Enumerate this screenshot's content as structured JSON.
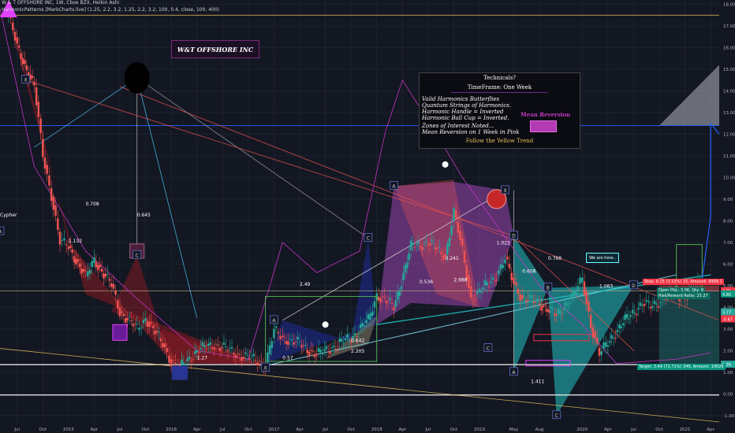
{
  "header": {
    "line1": "W & T OFFSHORE INC, 1W, Cboe BZX, Heikin Ashi",
    "line2": "HarmonicPatterns [MarkCharts.live] (1.25, 2.2, 3.2, 1.25, 2.2, 3.2, 100, 0.4, close, 100, 400)"
  },
  "title_box": "W&T OFFSHORE INC",
  "panel": {
    "heading": "Technicals?",
    "timeframe": "TimeFrame: One Week",
    "lines": [
      "Valid Harmonics Butterflies",
      "Quantum Strings of Harmonics.",
      "Harmonic Handle = Inverted",
      "Harmonic Ball Cup = Inverted."
    ],
    "lines2": [
      "Zones of Interest Noted...",
      "Mean Reversion on 1 Week in Pink"
    ],
    "mean_reversion": "Mean Reversion",
    "follow": "Follow the Yellow Trend"
  },
  "we_are_here": "We are here..",
  "position": {
    "stop": "Stop: 0.15 (3.13%) 15, Amount: 9999.1",
    "open": "Open P&L: 3.06, Qty: 6",
    "ratio": "Risk/Reward Ratio: 23.27",
    "target": "Target: 3.49 (72.71%) 349, Amount: 10026"
  },
  "price_tags": [
    {
      "label": "4.75",
      "y": 4.75,
      "color": "#f23645"
    },
    {
      "label": "4.80",
      "y": 4.6,
      "color": "#089981"
    },
    {
      "label": "3.77",
      "y": 3.77,
      "color": "#26a69a"
    },
    {
      "label": "-0.67",
      "y": 3.45,
      "color": "#f23645"
    },
    {
      "label": "1.35",
      "y": 1.35,
      "color": "#26a69a"
    }
  ],
  "colors": {
    "background": "#131722",
    "up": "#26a69a",
    "down": "#ef5350",
    "cup": "#b84fd0",
    "butterfly_red": "#8b1a22",
    "teal": "#22c1c3",
    "blue": "#1c2a8a",
    "yellow": "#e8c25a"
  },
  "chart_data": {
    "type": "candlestick",
    "title": "W & T OFFSHORE INC, 1W, Cboe BZX, Heikin Ashi",
    "xlabel": "",
    "ylabel": "",
    "ylim": [
      -1.3,
      18.2
    ],
    "y_ticks": [
      -1.0,
      0.0,
      1.0,
      2.0,
      3.0,
      4.0,
      5.0,
      6.0,
      7.0,
      8.0,
      9.0,
      10.0,
      11.0,
      12.0,
      13.0,
      14.0,
      15.0,
      16.0,
      17.0,
      18.0
    ],
    "x_range": [
      "2014-05",
      "2021-05"
    ],
    "x_ticks": [
      {
        "label": "Jul",
        "date": "2014-07"
      },
      {
        "label": "Oct",
        "date": "2014-10"
      },
      {
        "label": "2015",
        "date": "2015-01"
      },
      {
        "label": "Apr",
        "date": "2015-04"
      },
      {
        "label": "Jul",
        "date": "2015-07"
      },
      {
        "label": "Oct",
        "date": "2015-10"
      },
      {
        "label": "2016",
        "date": "2016-01"
      },
      {
        "label": "Apr",
        "date": "2016-04"
      },
      {
        "label": "Jul",
        "date": "2016-07"
      },
      {
        "label": "Oct",
        "date": "2016-10"
      },
      {
        "label": "2017",
        "date": "2017-01"
      },
      {
        "label": "Apr",
        "date": "2017-04"
      },
      {
        "label": "Jul",
        "date": "2017-07"
      },
      {
        "label": "Oct",
        "date": "2017-10"
      },
      {
        "label": "2018",
        "date": "2018-01"
      },
      {
        "label": "Apr",
        "date": "2018-04"
      },
      {
        "label": "Jul",
        "date": "2018-07"
      },
      {
        "label": "Oct",
        "date": "2018-10"
      },
      {
        "label": "2019",
        "date": "2019-01"
      },
      {
        "label": "May",
        "date": "2019-05"
      },
      {
        "label": "Aug",
        "date": "2019-08"
      },
      {
        "label": "2020",
        "date": "2020-01"
      },
      {
        "label": "Apr",
        "date": "2020-04"
      },
      {
        "label": "Jul",
        "date": "2020-07"
      },
      {
        "label": "Oct",
        "date": "2020-10"
      },
      {
        "label": "2021",
        "date": "2021-01"
      },
      {
        "label": "Apr",
        "date": "2021-04"
      }
    ],
    "price_path": [
      [
        "2014-06",
        17.5
      ],
      [
        "2014-07",
        16.0
      ],
      [
        "2014-09",
        14.2
      ],
      [
        "2014-10",
        11.0
      ],
      [
        "2014-11",
        9.2
      ],
      [
        "2014-12",
        7.0
      ],
      [
        "2015-01",
        6.8
      ],
      [
        "2015-03",
        5.4
      ],
      [
        "2015-04",
        6.2
      ],
      [
        "2015-06",
        5.0
      ],
      [
        "2015-07",
        3.8
      ],
      [
        "2015-09",
        3.0
      ],
      [
        "2015-10",
        3.5
      ],
      [
        "2015-12",
        2.3
      ],
      [
        "2016-01",
        1.5
      ],
      [
        "2016-02",
        1.2
      ],
      [
        "2016-04",
        2.0
      ],
      [
        "2016-06",
        2.3
      ],
      [
        "2016-09",
        1.8
      ],
      [
        "2016-12",
        1.4
      ],
      [
        "2017-01",
        2.9
      ],
      [
        "2017-02",
        2.6
      ],
      [
        "2017-04",
        2.3
      ],
      [
        "2017-06",
        1.8
      ],
      [
        "2017-08",
        2.2
      ],
      [
        "2017-10",
        2.6
      ],
      [
        "2017-12",
        3.4
      ],
      [
        "2018-01",
        4.6
      ],
      [
        "2018-03",
        4.0
      ],
      [
        "2018-05",
        6.8
      ],
      [
        "2018-07",
        7.0
      ],
      [
        "2018-09",
        6.4
      ],
      [
        "2018-10",
        8.4
      ],
      [
        "2018-11",
        6.6
      ],
      [
        "2018-12",
        4.4
      ],
      [
        "2019-01",
        4.7
      ],
      [
        "2019-03",
        5.5
      ],
      [
        "2019-04",
        6.2
      ],
      [
        "2019-05",
        5.1
      ],
      [
        "2019-06",
        4.4
      ],
      [
        "2019-08",
        4.2
      ],
      [
        "2019-10",
        3.6
      ],
      [
        "2019-12",
        4.6
      ],
      [
        "2020-01",
        5.3
      ],
      [
        "2020-02",
        3.2
      ],
      [
        "2020-03",
        1.8
      ],
      [
        "2020-04",
        2.4
      ],
      [
        "2020-06",
        3.4
      ],
      [
        "2020-08",
        4.2
      ],
      [
        "2020-09",
        4.0
      ],
      [
        "2020-11",
        4.6
      ],
      [
        "2021-01",
        4.5
      ],
      [
        "2021-02",
        4.8
      ],
      [
        "2021-03",
        5.3
      ]
    ],
    "projection": [
      [
        "2021-03",
        5.3
      ],
      [
        "2021-04",
        8.2
      ],
      [
        "2021-04",
        12.5
      ],
      [
        "2021-05",
        12.0
      ]
    ],
    "labels": [
      {
        "text": "Cypher",
        "date": "2014-05",
        "y": 8.2,
        "color": "#ffffff"
      },
      {
        "text": "0.708",
        "date": "2015-03",
        "y": 8.7,
        "color": "#ffffff"
      },
      {
        "text": "0.645",
        "date": "2015-09",
        "y": 8.2,
        "color": "#ffffff"
      },
      {
        "text": "1.132",
        "date": "2015-01",
        "y": 7.0,
        "color": "#ffffff"
      },
      {
        "text": "2.49",
        "date": "2017-04",
        "y": 5.0,
        "color": "#ffffff"
      },
      {
        "text": "1.27",
        "date": "2016-04",
        "y": 1.6,
        "color": "#ffffff"
      },
      {
        "text": "0.642",
        "date": "2017-10",
        "y": 2.4,
        "color": "#ffffff"
      },
      {
        "text": "2.205",
        "date": "2017-10",
        "y": 1.9,
        "color": "#ffffff"
      },
      {
        "text": "0.57",
        "date": "2017-02",
        "y": 1.6,
        "color": "#ffffff"
      },
      {
        "text": "0.241",
        "date": "2018-09",
        "y": 6.2,
        "color": "#ffffff"
      },
      {
        "text": "0.536",
        "date": "2018-06",
        "y": 5.1,
        "color": "#ffffff"
      },
      {
        "text": "2.988",
        "date": "2018-10",
        "y": 5.2,
        "color": "#ffffff"
      },
      {
        "text": "1.022",
        "date": "2019-03",
        "y": 6.9,
        "color": "#ffffff"
      },
      {
        "text": "0.768",
        "date": "2019-09",
        "y": 6.2,
        "color": "#ffffff"
      },
      {
        "text": "0.608",
        "date": "2019-06",
        "y": 5.6,
        "color": "#ffffff"
      },
      {
        "text": "1.063",
        "date": "2020-03",
        "y": 4.9,
        "color": "#ffffff"
      },
      {
        "text": "1.411",
        "date": "2019-07",
        "y": 0.5,
        "color": "#ffffff"
      }
    ],
    "pattern_points": [
      {
        "text": "X",
        "date": "2014-08",
        "y": 14.5
      },
      {
        "text": "A",
        "date": "2014-05",
        "y": 7.5
      },
      {
        "text": "C",
        "date": "2015-09",
        "y": 6.4
      },
      {
        "text": "X",
        "date": "2016-12",
        "y": 1.2
      },
      {
        "text": "A",
        "date": "2017-01",
        "y": 3.4
      },
      {
        "text": "C",
        "date": "2017-12",
        "y": 7.2
      },
      {
        "text": "A",
        "date": "2018-03",
        "y": 9.6
      },
      {
        "text": "X",
        "date": "2019-04",
        "y": 9.4
      },
      {
        "text": "D",
        "date": "2019-05",
        "y": 7.3
      },
      {
        "text": "C",
        "date": "2019-02",
        "y": 2.1
      },
      {
        "text": "B",
        "date": "2019-09",
        "y": 4.9
      },
      {
        "text": "A",
        "date": "2019-05",
        "y": 1.0
      },
      {
        "text": "C",
        "date": "2019-10",
        "y": -1.0
      },
      {
        "text": "D",
        "date": "2020-07",
        "y": 5.0
      }
    ]
  }
}
